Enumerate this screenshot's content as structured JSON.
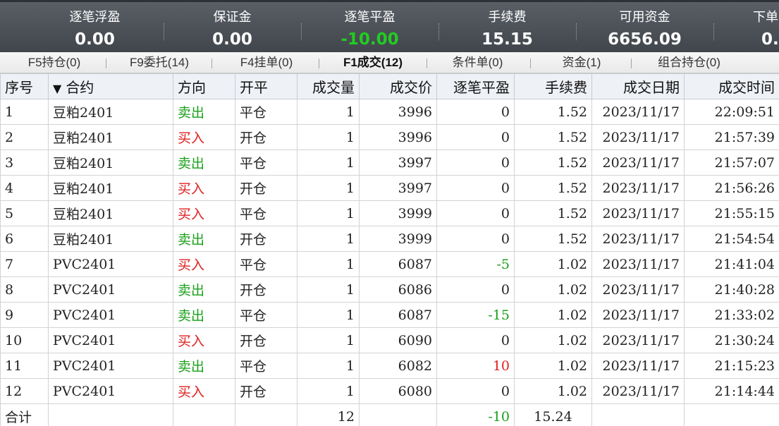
{
  "summary": [
    {
      "label": "逐笔浮盈",
      "value": "0.00",
      "color": "#ffffff"
    },
    {
      "label": "保证金",
      "value": "0.00",
      "color": "#ffffff"
    },
    {
      "label": "逐笔平盈",
      "value": "-10.00",
      "color": "#22cc22"
    },
    {
      "label": "手续费",
      "value": "15.15",
      "color": "#ffffff"
    },
    {
      "label": "可用资金",
      "value": "6656.09",
      "color": "#ffffff"
    },
    {
      "label": "下单",
      "value": "0.",
      "color": "#ffffff"
    }
  ],
  "tabs": [
    "F5持仓(0)",
    "F9委托(14)",
    "F4挂单(0)",
    "F1成交(12)",
    "条件单(0)",
    "资金(1)",
    "组合持仓(0)"
  ],
  "active_tab": "F1成交(12)",
  "table": {
    "headers": [
      "序号",
      "合约",
      "方向",
      "开平",
      "成交量",
      "成交价",
      "逐笔平盈",
      "手续费",
      "成交日期",
      "成交时间"
    ],
    "rows": [
      [
        "1",
        "豆粕2401",
        "卖出",
        "平仓",
        "1",
        "3996",
        "0",
        "1.52",
        "2023/11/17",
        "22:09:51"
      ],
      [
        "2",
        "豆粕2401",
        "买入",
        "开仓",
        "1",
        "3996",
        "0",
        "1.52",
        "2023/11/17",
        "21:57:39"
      ],
      [
        "3",
        "豆粕2401",
        "卖出",
        "平仓",
        "1",
        "3997",
        "0",
        "1.52",
        "2023/11/17",
        "21:57:07"
      ],
      [
        "4",
        "豆粕2401",
        "买入",
        "开仓",
        "1",
        "3997",
        "0",
        "1.52",
        "2023/11/17",
        "21:56:26"
      ],
      [
        "5",
        "豆粕2401",
        "买入",
        "平仓",
        "1",
        "3999",
        "0",
        "1.52",
        "2023/11/17",
        "21:55:15"
      ],
      [
        "6",
        "豆粕2401",
        "卖出",
        "开仓",
        "1",
        "3999",
        "0",
        "1.52",
        "2023/11/17",
        "21:54:54"
      ],
      [
        "7",
        "PVC2401",
        "买入",
        "平仓",
        "1",
        "6087",
        "-5",
        "1.02",
        "2023/11/17",
        "21:41:04"
      ],
      [
        "8",
        "PVC2401",
        "卖出",
        "开仓",
        "1",
        "6086",
        "0",
        "1.02",
        "2023/11/17",
        "21:40:28"
      ],
      [
        "9",
        "PVC2401",
        "卖出",
        "平仓",
        "1",
        "6087",
        "-15",
        "1.02",
        "2023/11/17",
        "21:33:02"
      ],
      [
        "10",
        "PVC2401",
        "买入",
        "开仓",
        "1",
        "6090",
        "0",
        "1.02",
        "2023/11/17",
        "21:30:24"
      ],
      [
        "11",
        "PVC2401",
        "卖出",
        "平仓",
        "1",
        "6082",
        "10",
        "1.02",
        "2023/11/17",
        "21:15:23"
      ],
      [
        "12",
        "PVC2401",
        "买入",
        "开仓",
        "1",
        "6080",
        "0",
        "1.02",
        "2023/11/17",
        "21:14:44"
      ]
    ],
    "total": {
      "label": "合计",
      "volume": "12",
      "pnl": "-10",
      "fee": "15.24"
    }
  },
  "colors": {
    "buy": "#e02020",
    "sell": "#1aa01a",
    "loss": "#1aa01a",
    "profit": "#e02020"
  }
}
